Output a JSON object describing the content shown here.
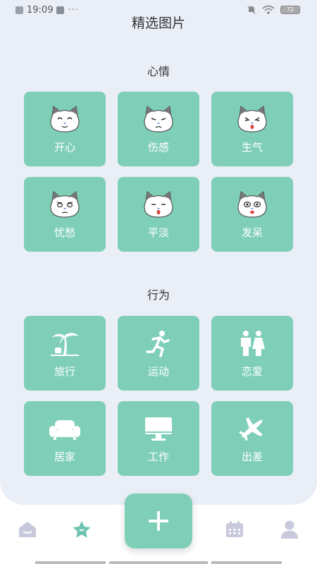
{
  "status": {
    "time": "19:09",
    "more": "···",
    "battery": "72"
  },
  "title": "精选图片",
  "mood": {
    "title": "心情",
    "items": [
      {
        "label": "开心",
        "icon": "cat-happy-icon"
      },
      {
        "label": "伤感",
        "icon": "cat-sad-icon"
      },
      {
        "label": "生气",
        "icon": "cat-angry-icon"
      },
      {
        "label": "忧愁",
        "icon": "cat-worried-icon"
      },
      {
        "label": "平淡",
        "icon": "cat-calm-icon"
      },
      {
        "label": "发呆",
        "icon": "cat-daze-icon"
      }
    ]
  },
  "behavior": {
    "title": "行为",
    "items": [
      {
        "label": "旅行",
        "icon": "palm-tree-icon"
      },
      {
        "label": "运动",
        "icon": "running-icon"
      },
      {
        "label": "恋爱",
        "icon": "couple-icon"
      },
      {
        "label": "居家",
        "icon": "sofa-icon"
      },
      {
        "label": "工作",
        "icon": "monitor-icon"
      },
      {
        "label": "出差",
        "icon": "airplane-icon"
      }
    ]
  },
  "tabbar": {
    "items": [
      "home-tab-icon",
      "star-tab-icon",
      "add-icon",
      "calendar-tab-icon",
      "profile-tab-icon"
    ],
    "active": "star-tab-icon"
  },
  "colors": {
    "accent": "#7fcfb8",
    "panel_bg": "#e9eef7",
    "tab_inactive": "#c9c9dd",
    "star_active": "#6cc4b0"
  }
}
